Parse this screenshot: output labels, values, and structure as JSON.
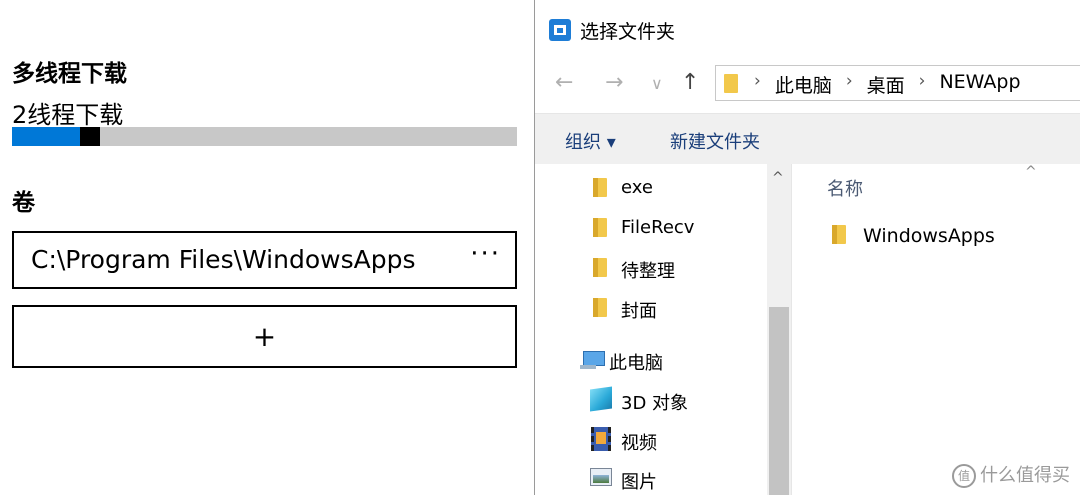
{
  "settings": {
    "download_title": "多线程下载",
    "threads_label": "2线程下载",
    "threads_slider_fraction": 0.17,
    "volume_title": "卷",
    "volume_path": "C:\\Program Files\\WindowsApps",
    "more_label": "···",
    "add_label": "+"
  },
  "dialog": {
    "title": "选择文件夹",
    "nav": {
      "back": "←",
      "forward": "→",
      "recent": "∨",
      "up": "↑"
    },
    "breadcrumb": [
      "此电脑",
      "桌面",
      "NEWApp"
    ],
    "breadcrumb_sep": "›",
    "toolbar": {
      "organize": "组织 ▾",
      "new_folder": "新建文件夹"
    },
    "nav_items": [
      {
        "label": "exe",
        "icon": "folder-icon"
      },
      {
        "label": "FileRecv",
        "icon": "folder-icon"
      },
      {
        "label": "待整理",
        "icon": "folder-icon"
      },
      {
        "label": "封面",
        "icon": "folder-icon"
      },
      {
        "label": "此电脑",
        "icon": "computer-icon"
      },
      {
        "label": "3D 对象",
        "icon": "3d-objects-icon"
      },
      {
        "label": "视频",
        "icon": "video-icon"
      },
      {
        "label": "图片",
        "icon": "pictures-icon"
      }
    ],
    "scroll_up": "^",
    "column_name": "名称",
    "sort_indicator": "^",
    "files": [
      {
        "name": "WindowsApps",
        "icon": "folder-icon"
      }
    ]
  },
  "watermark": {
    "badge": "值",
    "text": "什么值得买"
  },
  "colors": {
    "accent": "#0078d7",
    "slider_track": "#c8c8c8",
    "folder": "#f2c84b",
    "toolbar_bg": "#f0f0f0"
  }
}
